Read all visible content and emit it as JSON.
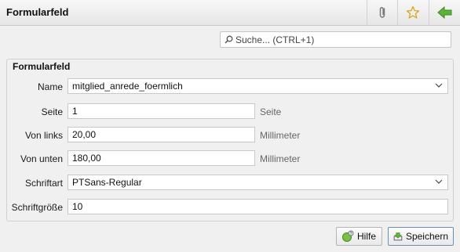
{
  "window": {
    "title": "Formularfeld"
  },
  "toolbar": {
    "attach_icon": "paperclip-icon",
    "favorite_icon": "star-icon",
    "back_icon": "arrow-left-icon"
  },
  "search": {
    "placeholder": "Suche...  (CTRL+1)"
  },
  "form": {
    "group_title": "Formularfeld",
    "fields": {
      "name": {
        "label": "Name",
        "value": "mitglied_anrede_foermlich"
      },
      "seite": {
        "label": "Seite",
        "value": "1",
        "unit": "Seite"
      },
      "von_links": {
        "label": "Von links",
        "value": "20,00",
        "unit": "Millimeter"
      },
      "von_unten": {
        "label": "Von unten",
        "value": "180,00",
        "unit": "Millimeter"
      },
      "schriftart": {
        "label": "Schriftart",
        "value": "PTSans-Regular"
      },
      "schriftgroesse": {
        "label": "Schriftgröße",
        "value": "10"
      }
    }
  },
  "buttons": {
    "help": "Hilfe",
    "save": "Speichern"
  },
  "colors": {
    "accent_green": "#4a9a2e",
    "star": "#d9a520"
  }
}
